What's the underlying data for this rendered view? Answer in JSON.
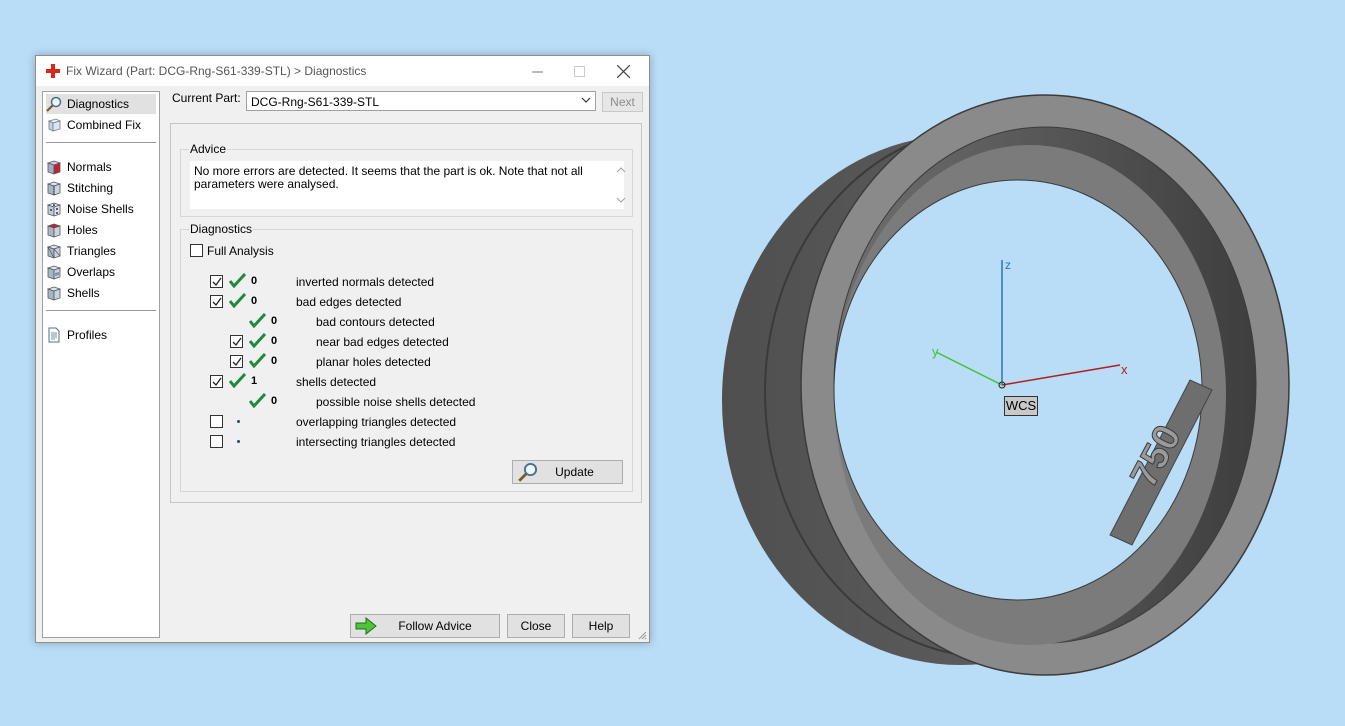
{
  "window": {
    "title": "Fix Wizard (Part: DCG-Rng-S61-339-STL) > Diagnostics",
    "brand_color": "#d9261c"
  },
  "sidebar": {
    "items": [
      {
        "label": "Diagnostics",
        "icon": "magnifier-icon",
        "selected": true
      },
      {
        "label": "Combined Fix",
        "icon": "cube-icon"
      },
      {
        "label": "Normals",
        "icon": "cube-red-face-icon"
      },
      {
        "label": "Stitching",
        "icon": "cube-stitch-icon"
      },
      {
        "label": "Noise Shells",
        "icon": "dice-icon"
      },
      {
        "label": "Holes",
        "icon": "cube-hole-icon"
      },
      {
        "label": "Triangles",
        "icon": "cube-triangles-icon"
      },
      {
        "label": "Overlaps",
        "icon": "cube-overlap-icon"
      },
      {
        "label": "Shells",
        "icon": "cube-shell-icon"
      },
      {
        "label": "Profiles",
        "icon": "document-icon"
      }
    ]
  },
  "current_part": {
    "label": "Current Part:",
    "value": "DCG-Rng-S61-339-STL",
    "next_label": "Next"
  },
  "advice": {
    "title": "Advice",
    "text": "No more errors are detected. It seems that the part is ok. Note that not all parameters were analysed."
  },
  "diagnostics": {
    "title": "Diagnostics",
    "full_analysis_label": "Full Analysis",
    "full_analysis_checked": false,
    "rows": [
      {
        "count": "0",
        "label": "inverted normals detected",
        "checked": true,
        "status": "ok",
        "indent": 0,
        "has_checkbox": true
      },
      {
        "count": "0",
        "label": "bad edges detected",
        "checked": true,
        "status": "ok",
        "indent": 0,
        "has_checkbox": true
      },
      {
        "count": "0",
        "label": "bad contours detected",
        "checked": false,
        "status": "ok",
        "indent": 1,
        "has_checkbox": false
      },
      {
        "count": "0",
        "label": "near bad edges detected",
        "checked": true,
        "status": "ok",
        "indent": 1,
        "has_checkbox": true
      },
      {
        "count": "0",
        "label": "planar holes detected",
        "checked": true,
        "status": "ok",
        "indent": 1,
        "has_checkbox": true
      },
      {
        "count": "1",
        "label": "shells detected",
        "checked": true,
        "status": "ok",
        "indent": 0,
        "has_checkbox": true
      },
      {
        "count": "0",
        "label": "possible noise shells detected",
        "checked": false,
        "status": "ok",
        "indent": 1,
        "has_checkbox": false
      },
      {
        "count": "",
        "label": "overlapping triangles detected",
        "checked": false,
        "status": "pending",
        "indent": 0,
        "has_checkbox": true
      },
      {
        "count": "",
        "label": "intersecting triangles detected",
        "checked": false,
        "status": "pending",
        "indent": 0,
        "has_checkbox": true
      }
    ],
    "update_label": "Update",
    "ok_color": "#1f8a3c"
  },
  "buttons": {
    "follow_advice": "Follow Advice",
    "close": "Close",
    "help": "Help"
  },
  "viewport": {
    "wcs_label": "WCS",
    "axis_x": "x",
    "axis_y": "y",
    "axis_z": "z",
    "engraving": "750",
    "colors": {
      "x": "#b01f1f",
      "y": "#3cc63c",
      "z": "#2b73c8",
      "part": "#7d7d7d"
    }
  }
}
